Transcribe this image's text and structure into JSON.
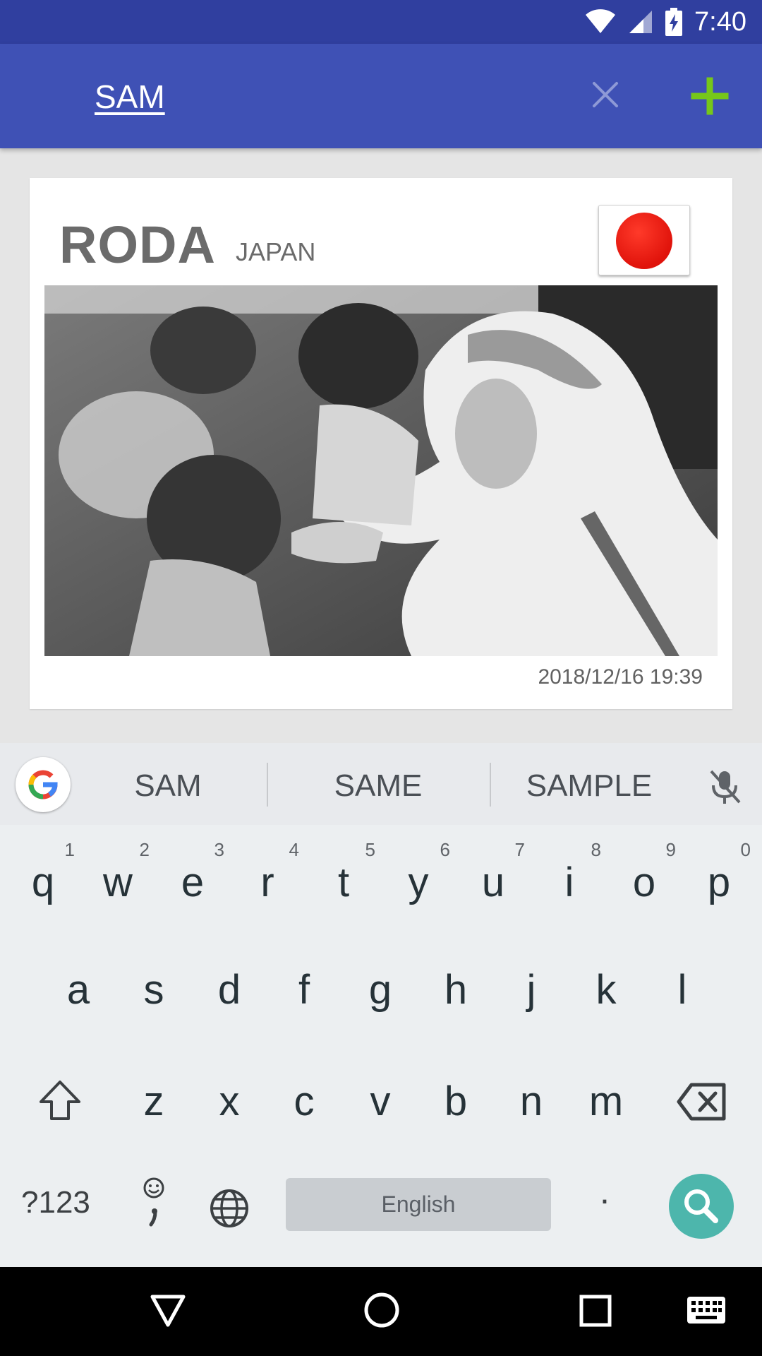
{
  "status_bar": {
    "time": "7:40"
  },
  "app_bar": {
    "search_query": "SAM",
    "clear_icon": "close-icon",
    "add_icon": "plus-icon",
    "add_color": "#76c71a"
  },
  "card": {
    "title": "RODA",
    "country": "JAPAN",
    "flag": "japan-flag",
    "date": "2018/12/16 19:39"
  },
  "keyboard": {
    "suggestions": [
      "SAM",
      "SAME",
      "SAMPLE"
    ],
    "row1": [
      "q",
      "w",
      "e",
      "r",
      "t",
      "y",
      "u",
      "i",
      "o",
      "p"
    ],
    "row1_hints": [
      "1",
      "2",
      "3",
      "4",
      "5",
      "6",
      "7",
      "8",
      "9",
      "0"
    ],
    "row2": [
      "a",
      "s",
      "d",
      "f",
      "g",
      "h",
      "j",
      "k",
      "l"
    ],
    "row3": [
      "z",
      "x",
      "c",
      "v",
      "b",
      "n",
      "m"
    ],
    "symbols_label": "?123",
    "space_label": "English",
    "period_label": ".",
    "accent_color": "#4db6ac"
  }
}
